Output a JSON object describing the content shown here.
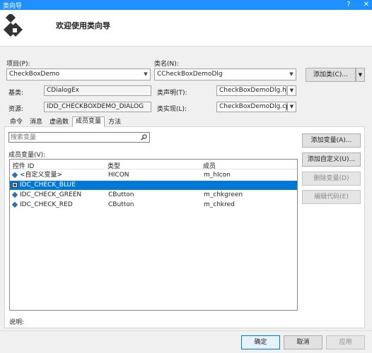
{
  "window": {
    "title": "类向导",
    "help": "?",
    "close": "✕"
  },
  "header": {
    "title": "欢迎使用类向导"
  },
  "project": {
    "label": "项目(P):",
    "value": "CheckBoxDemo"
  },
  "classname": {
    "label": "类名(N):",
    "value": "CCheckBoxDemoDlg"
  },
  "add_class_button": "添加类(C)...",
  "base": {
    "label": "基类:",
    "value": "CDialogEx"
  },
  "resource": {
    "label": "资源:",
    "value": "IDD_CHECKBOXDEMO_DIALOG"
  },
  "declaration": {
    "label": "类声明(T):",
    "value": "CheckBoxDemoDlg.h"
  },
  "implementation": {
    "label": "类实现(L):",
    "value": "CheckBoxDemoDlg.cpp"
  },
  "tabs": [
    {
      "label": "命令"
    },
    {
      "label": "消息"
    },
    {
      "label": "虚函数"
    },
    {
      "label": "成员变量"
    },
    {
      "label": "方法"
    }
  ],
  "search": {
    "placeholder": "搜索变量"
  },
  "members_label": "成员变量(V):",
  "columns": {
    "control_id": "控件 ID",
    "type": "类型",
    "member": "成员"
  },
  "rows": [
    {
      "id": "<自定义变量>",
      "type": "HICON",
      "member": "m_hIcon"
    },
    {
      "id": "IDC_CHECK_BLUE",
      "type": "",
      "member": ""
    },
    {
      "id": "IDC_CHECK_GREEN",
      "type": "CButton",
      "member": "m_chkgreen"
    },
    {
      "id": "IDC_CHECK_RED",
      "type": "CButton",
      "member": "m_chkred"
    }
  ],
  "side_buttons": {
    "add_var": "添加变量(A)...",
    "add_custom": "添加自定义(U)...",
    "delete_var": "删除变量(D)",
    "edit_code": "编辑代码(E)"
  },
  "description_label": "说明:",
  "footer": {
    "ok": "确定",
    "cancel": "取消",
    "apply": "应用"
  },
  "colors": {
    "titlebar": "#1e90ff",
    "selection": "#0078d7"
  }
}
